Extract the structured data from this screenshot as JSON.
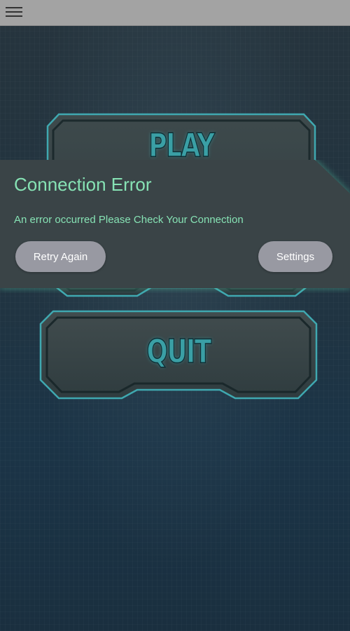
{
  "topbar": {
    "menu_icon": "hamburger-menu-icon"
  },
  "menu": {
    "play_label": "PLAY",
    "quit_label": "QUIT"
  },
  "dialog": {
    "title": "Connection Error",
    "message": "An error occurred Please Check Your Connection",
    "retry_label": "Retry Again",
    "settings_label": "Settings"
  },
  "colors": {
    "dialog_bg": "#3a4447",
    "dialog_glow": "#58c9a6",
    "dialog_text": "#86e2b4",
    "pill_button": "#9899a2",
    "menu_text": "#3a9fa5",
    "topbar": "#a3a3a3"
  }
}
